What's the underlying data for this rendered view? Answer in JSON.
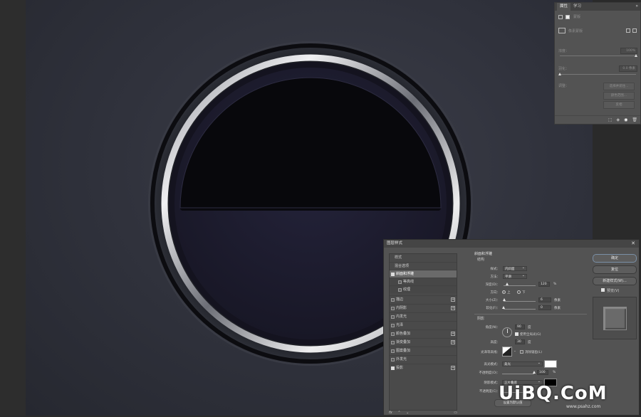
{
  "properties_panel": {
    "tabs": [
      "属性",
      "学习"
    ],
    "mask_label": "蒙版",
    "pixel_mask_label": "像素蒙版",
    "density_label": "浓度：",
    "density_value": "100%",
    "feather_label": "羽化：",
    "feather_value": "0.0 像素",
    "refine_label": "调整：",
    "buttons": [
      "选择并遮住...",
      "颜色范围...",
      "反相"
    ]
  },
  "dialog": {
    "title": "图层样式",
    "styles_list": [
      {
        "label": "样式",
        "type": "header"
      },
      {
        "label": "混合选项",
        "type": "header"
      },
      {
        "label": "斜面和浮雕",
        "type": "item",
        "checked": true,
        "selected": true
      },
      {
        "label": "等高线",
        "type": "sub",
        "checked": false
      },
      {
        "label": "纹理",
        "type": "sub",
        "checked": false
      },
      {
        "label": "描边",
        "type": "item",
        "checked": false,
        "plus": true
      },
      {
        "label": "内阴影",
        "type": "item",
        "checked": false,
        "plus": true
      },
      {
        "label": "内发光",
        "type": "item",
        "checked": false
      },
      {
        "label": "光泽",
        "type": "item",
        "checked": false
      },
      {
        "label": "颜色叠加",
        "type": "item",
        "checked": false,
        "plus": true
      },
      {
        "label": "渐变叠加",
        "type": "item",
        "checked": false,
        "plus": true
      },
      {
        "label": "图案叠加",
        "type": "item",
        "checked": false
      },
      {
        "label": "外发光",
        "type": "item",
        "checked": false
      },
      {
        "label": "投影",
        "type": "item",
        "checked": true,
        "plus": true
      }
    ],
    "list_footer": "fx",
    "section_title": "斜面和浮雕",
    "structure_label": "结构",
    "style_label": "样式：",
    "style_value": "内斜面",
    "technique_label": "方法：",
    "technique_value": "平滑",
    "depth_label": "深度(D)：",
    "depth_value": "120",
    "depth_unit": "%",
    "depth_fraction": 0.12,
    "direction_label": "方向：",
    "direction_up": "上",
    "direction_down": "下",
    "size_label": "大小(Z)：",
    "size_value": "6",
    "size_unit": "像素",
    "soften_label": "软化(F)：",
    "soften_value": "0",
    "soften_unit": "像素",
    "shading_label": "阴影",
    "angle_label": "角度(N)：",
    "angle_value": "90",
    "angle_unit": "度",
    "global_light_label": "使用全局光(G)",
    "altitude_label": "高度：",
    "altitude_value": "30",
    "altitude_unit": "度",
    "gloss_contour_label": "光泽等高线：",
    "antialias_label": "消除锯齿(L)",
    "highlight_mode_label": "高光模式：",
    "highlight_mode_value": "柔光",
    "highlight_color": "#ffffff",
    "opacity_label": "不透明度(O)：",
    "highlight_opacity": "100",
    "opacity_unit": "%",
    "shadow_mode_label": "阴影模式：",
    "shadow_mode_value": "正片叠底",
    "shadow_color": "#000000",
    "shadow_opacity_label": "不透明度(C)：",
    "default_button": "设置为默认值",
    "ok": "确定",
    "reset": "复位",
    "new_style": "新建样式(W)...",
    "preview_label": "预览(V)"
  },
  "watermark": {
    "main": "UiBQ.CoM",
    "sub": "www.psahz.com"
  }
}
